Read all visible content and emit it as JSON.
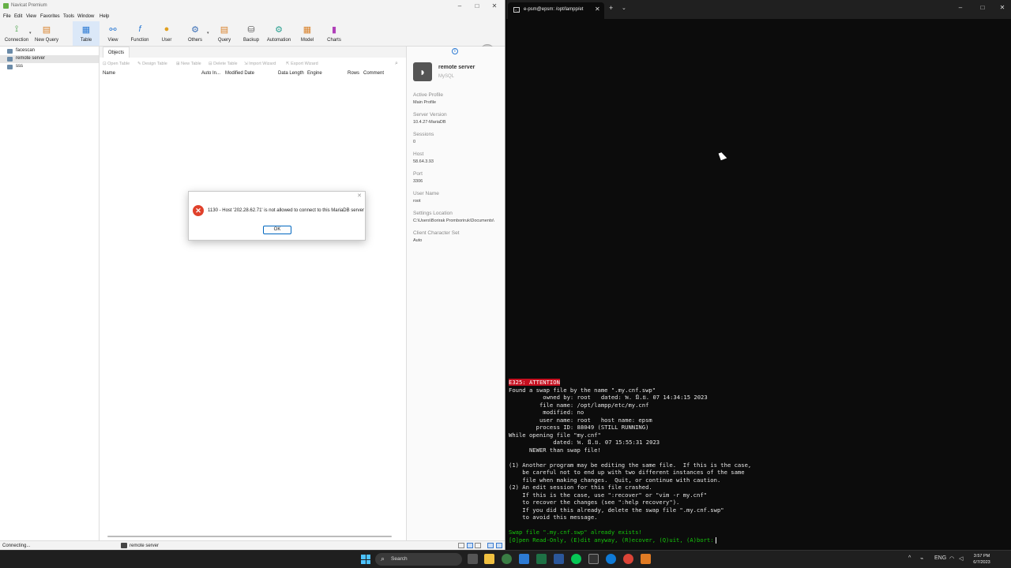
{
  "navicat": {
    "title": "Navicat Premium",
    "menu": [
      "File",
      "Edit",
      "View",
      "Favorites",
      "Tools",
      "Window",
      "Help"
    ],
    "toolbar": [
      {
        "label": "Connection",
        "icon": "connection-icon"
      },
      {
        "label": "New Query",
        "icon": "new-query-icon"
      },
      {
        "label": "Table",
        "icon": "table-icon"
      },
      {
        "label": "View",
        "icon": "view-icon"
      },
      {
        "label": "Function",
        "icon": "function-icon"
      },
      {
        "label": "User",
        "icon": "user-icon"
      },
      {
        "label": "Others",
        "icon": "others-icon"
      },
      {
        "label": "Query",
        "icon": "query-icon"
      },
      {
        "label": "Backup",
        "icon": "backup-icon"
      },
      {
        "label": "Automation",
        "icon": "automation-icon"
      },
      {
        "label": "Model",
        "icon": "model-icon"
      },
      {
        "label": "Charts",
        "icon": "charts-icon"
      }
    ],
    "connections": [
      {
        "label": "facescan"
      },
      {
        "label": "remote server"
      },
      {
        "label": "sss"
      }
    ],
    "objects_tab": "Objects",
    "object_tools": [
      "Open Table",
      "Design Table",
      "New Table",
      "Delete Table",
      "Import Wizard",
      "Export Wizard"
    ],
    "columns": [
      "Name",
      "Auto In...",
      "Modified Date",
      "Data Length",
      "Engine",
      "Rows",
      "Comment"
    ],
    "info": {
      "name": "remote server",
      "type": "MySQL",
      "fields": [
        {
          "label": "Active Profile",
          "value": "Main Profile"
        },
        {
          "label": "Server Version",
          "value": "10.4.27-MariaDB"
        },
        {
          "label": "Sessions",
          "value": "0"
        },
        {
          "label": "Host",
          "value": "58.64.3.93"
        },
        {
          "label": "Port",
          "value": "3306"
        },
        {
          "label": "User Name",
          "value": "root"
        },
        {
          "label": "Settings Location",
          "value": "C:\\Users\\Borirak Promboriruk\\Documents\\"
        },
        {
          "label": "Client Character Set",
          "value": "Auto"
        }
      ]
    },
    "status": {
      "text": "Connecting...",
      "connection": "remote server"
    },
    "dialog": {
      "message": "1130 - Host '202.28.62.71' is not allowed to connect to this MariaDB server",
      "ok_label": "OK"
    }
  },
  "terminal": {
    "tab_title": "e-psm@epsm: /opt/lampp/et",
    "lines": [
      {
        "text": "E325: ATTENTION",
        "style": "warn"
      },
      {
        "text": "Found a swap file by the name \".my.cnf.swp\"",
        "style": "normal"
      },
      {
        "text": "          owned by: root   dated: พ. มิ.ย. 07 14:34:15 2023",
        "style": "normal"
      },
      {
        "text": "         file name: /opt/lampp/etc/my.cnf",
        "style": "normal"
      },
      {
        "text": "          modified: no",
        "style": "normal"
      },
      {
        "text": "         user name: root   host name: epsm",
        "style": "normal"
      },
      {
        "text": "        process ID: 88049 (STILL RUNNING)",
        "style": "normal"
      },
      {
        "text": "While opening file \"my.cnf\"",
        "style": "normal"
      },
      {
        "text": "             dated: พ. มิ.ย. 07 15:55:31 2023",
        "style": "normal"
      },
      {
        "text": "      NEWER than swap file!",
        "style": "normal"
      },
      {
        "text": "",
        "style": "normal"
      },
      {
        "text": "(1) Another program may be editing the same file.  If this is the case,",
        "style": "normal"
      },
      {
        "text": "    be careful not to end up with two different instances of the same",
        "style": "normal"
      },
      {
        "text": "    file when making changes.  Quit, or continue with caution.",
        "style": "normal"
      },
      {
        "text": "(2) An edit session for this file crashed.",
        "style": "normal"
      },
      {
        "text": "    If this is the case, use \":recover\" or \"vim -r my.cnf\"",
        "style": "normal"
      },
      {
        "text": "    to recover the changes (see \":help recovery\").",
        "style": "normal"
      },
      {
        "text": "    If you did this already, delete the swap file \".my.cnf.swp\"",
        "style": "normal"
      },
      {
        "text": "    to avoid this message.",
        "style": "normal"
      },
      {
        "text": "",
        "style": "normal"
      },
      {
        "text": "Swap file \".my.cnf.swp\" already exists!",
        "style": "green"
      },
      {
        "text": "[O]pen Read-Only, (E)dit anyway, (R)ecover, (Q)uit, (A)bort:",
        "style": "green"
      }
    ]
  },
  "taskbar": {
    "search_label": "Search",
    "language": "ENG",
    "time": "3:57 PM",
    "date": "6/7/2023",
    "colors": {
      "accent": "#4cc2ff",
      "background": "#1f1f1f"
    }
  }
}
